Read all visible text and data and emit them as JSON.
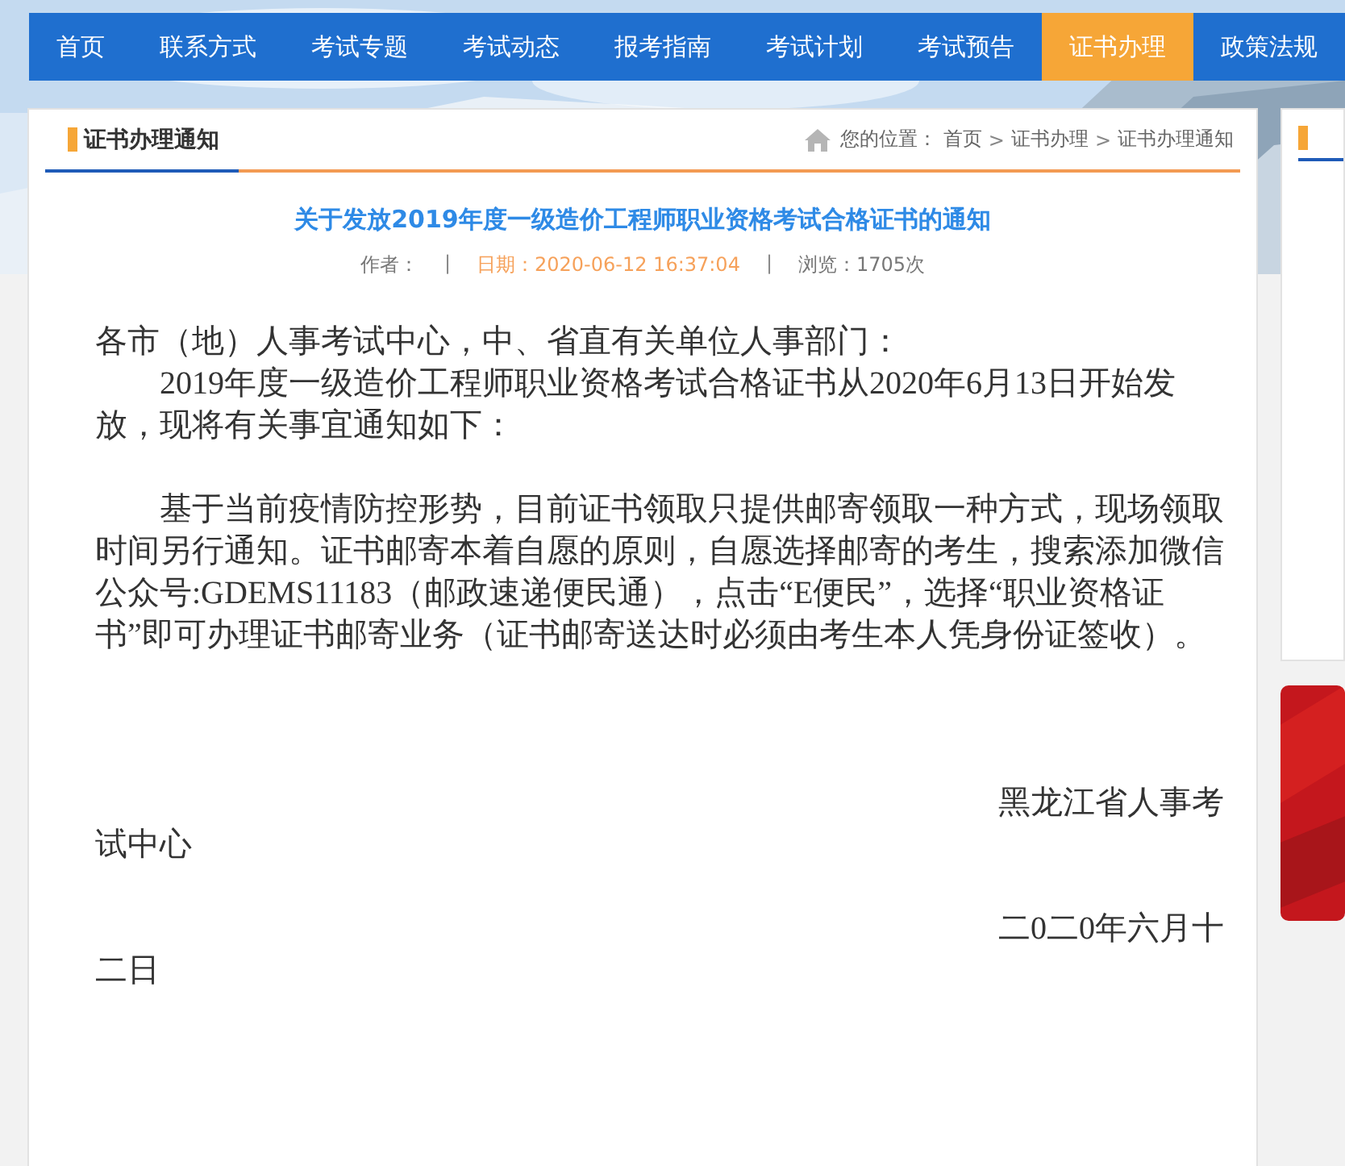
{
  "nav": [
    {
      "label": "首页",
      "selected": false
    },
    {
      "label": "联系方式",
      "selected": false
    },
    {
      "label": "考试专题",
      "selected": false
    },
    {
      "label": "考试动态",
      "selected": false
    },
    {
      "label": "报考指南",
      "selected": false
    },
    {
      "label": "考试计划",
      "selected": false
    },
    {
      "label": "考试预告",
      "selected": false
    },
    {
      "label": "证书办理",
      "selected": true
    },
    {
      "label": "政策法规",
      "selected": false
    }
  ],
  "section_title": "证书办理通知",
  "breadcrumb": {
    "prefix": "您的位置：",
    "items": [
      "首页",
      "证书办理",
      "证书办理通知"
    ],
    "separator": ">"
  },
  "article": {
    "title": "关于发放2019年度一级造价工程师职业资格考试合格证书的通知",
    "meta": {
      "author": "作者：",
      "date": "日期：2020-06-12 16:37:04",
      "views": "浏览：1705次",
      "separator": "|"
    },
    "paragraphs": [
      {
        "kind": "plain",
        "text": "各市（地）人事考试中心，中、省直有关单位人事部门："
      },
      {
        "kind": "indent",
        "text": "2019年度一级造价工程师职业资格考试合格证书从2020年6月13日开始发放，现将有关事宜通知如下："
      },
      {
        "kind": "gap"
      },
      {
        "kind": "indent",
        "text": "基于当前疫情防控形势，目前证书领取只提供邮寄领取一种方式，现场领取时间另行通知。证书邮寄本着自愿的原则，自愿选择邮寄的考生，搜索添加微信公众号:GDEMS11183（邮政速递便民通），点击“E便民”，选择“职业资格证书”即可办理证书邮寄业务（证书邮寄送达时必须由考生本人凭身份证签收）。"
      },
      {
        "kind": "gap"
      },
      {
        "kind": "gap"
      },
      {
        "kind": "gap"
      },
      {
        "kind": "sign",
        "text": "黑龙江省人事考试中心"
      },
      {
        "kind": "gap"
      },
      {
        "kind": "sign",
        "text": "二0二0年六月十二日"
      }
    ]
  }
}
